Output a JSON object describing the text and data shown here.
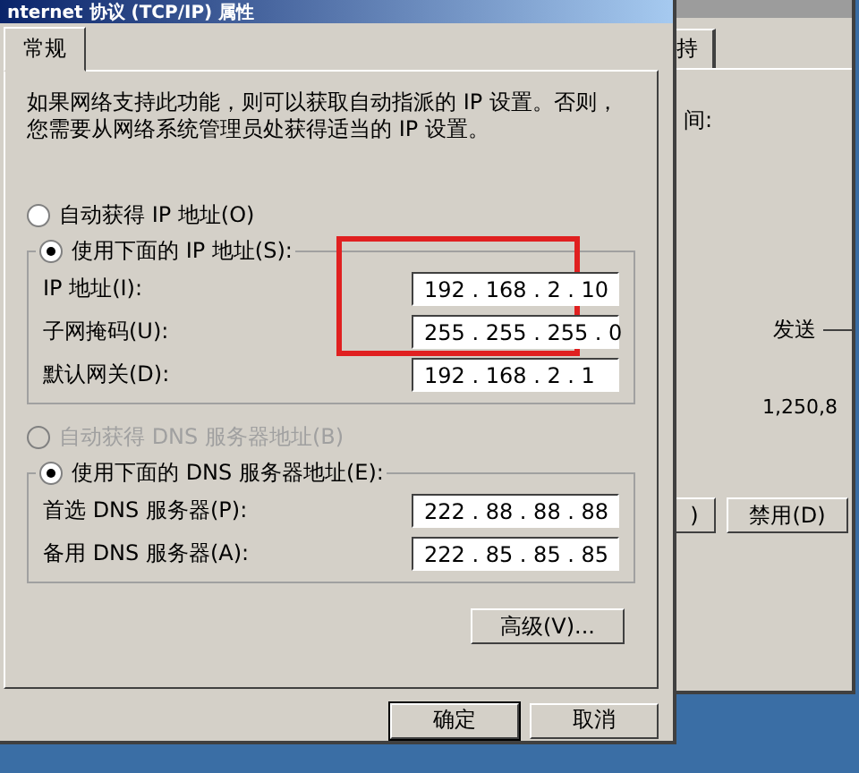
{
  "dialog": {
    "title": "nternet 协议 (TCP/IP) 属性",
    "tabs": [
      {
        "label": "常规",
        "selected": true
      }
    ],
    "intro": "如果网络支持此功能，则可以获取自动指派的 IP 设置。否则，您需要从网络系统管理员处获得适当的 IP 设置。",
    "ip_auto": {
      "label": "自动获得 IP 地址(O)",
      "selected": false,
      "disabled": false
    },
    "ip_manual": {
      "label": "使用下面的 IP 地址(S):",
      "selected": true,
      "disabled": false
    },
    "ip_fields": [
      {
        "label": "IP 地址(I):",
        "value": "192 . 168 . 2 . 10",
        "highlighted": true
      },
      {
        "label": "子网掩码(U):",
        "value": "255 . 255 . 255 . 0",
        "highlighted": true
      },
      {
        "label": "默认网关(D):",
        "value": "192 . 168 . 2 . 1",
        "highlighted": false
      }
    ],
    "dns_auto": {
      "label": "自动获得 DNS 服务器地址(B)",
      "selected": false,
      "disabled": true
    },
    "dns_manual": {
      "label": "使用下面的 DNS 服务器地址(E):",
      "selected": true,
      "disabled": false
    },
    "dns_fields": [
      {
        "label": "首选 DNS 服务器(P):",
        "value": "222 . 88 . 88 . 88",
        "highlighted": false
      },
      {
        "label": "备用 DNS 服务器(A):",
        "value": "222 . 85 . 85 . 85",
        "highlighted": false
      }
    ],
    "advanced_button": "高级(V)...",
    "buttons": [
      "确定",
      "取消"
    ]
  },
  "background_window": {
    "tab": "持",
    "label": "间:",
    "sent_label": "发送",
    "sent_value": "1,250,8",
    "buttons": [
      ")",
      "禁用(D)"
    ]
  }
}
